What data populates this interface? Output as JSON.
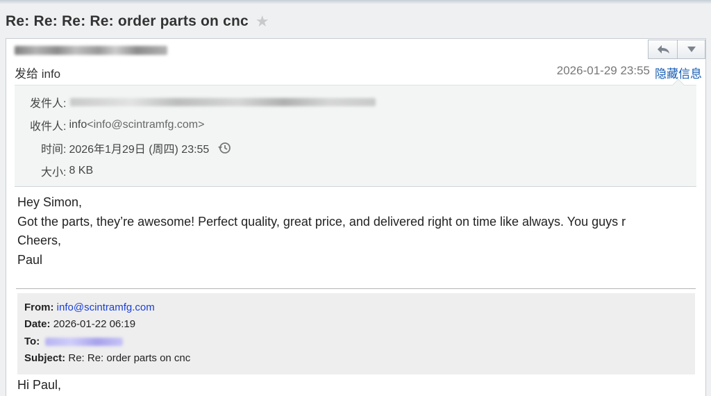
{
  "subject": {
    "title": "Re: Re: Re: Re: order parts on cnc"
  },
  "header": {
    "to_line": "发给 info",
    "date": "2026-01-29 23:55",
    "hide_details_link": "隐藏信息"
  },
  "details": {
    "from_label": "发件人:",
    "to_label": "收件人:",
    "to_name": "info",
    "to_email": "<info@scintramfg.com>",
    "time_label": "时间:",
    "time_value": "2026年1月29日 (周四) 23:55",
    "size_label": "大小:",
    "size_value": "8 KB"
  },
  "body": {
    "lines": [
      "Hey Simon,",
      "Got the parts, they’re awesome! Perfect quality, great price, and delivered right on time like always. You guys r",
      "Cheers,",
      "Paul"
    ]
  },
  "quoted": {
    "from_label": "From:",
    "from_value": "info@scintramfg.com",
    "date_label": "Date:",
    "date_value": "2026-01-22 06:19",
    "to_label": "To:",
    "subject_label": "Subject:",
    "subject_value": "Re: Re: order parts on cnc",
    "greeting": "Hi Paul,"
  },
  "icons": {
    "star": "star-icon",
    "reply": "reply-arrow-icon",
    "more": "chevron-down-icon",
    "history": "clock-history-icon"
  },
  "colors": {
    "link": "#1a5fb4",
    "quoted_link": "#1a3fd4",
    "details_bg": "#f3f5f5",
    "quote_bg": "#eeeeee"
  }
}
